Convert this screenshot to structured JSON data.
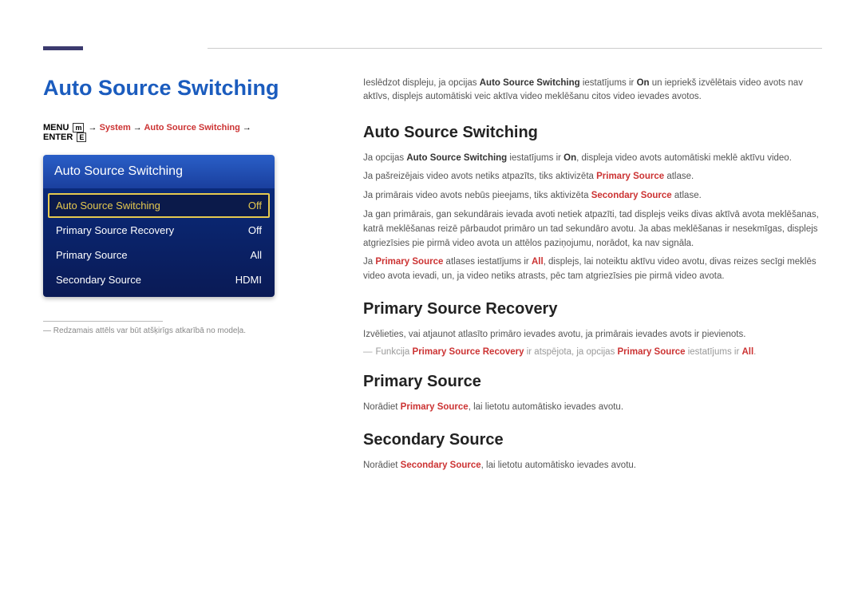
{
  "page_title": "Auto Source Switching",
  "nav": {
    "menu": "MENU",
    "menu_icon": "m",
    "arrow": "→",
    "system": "System",
    "item": "Auto Source Switching",
    "enter": "ENTER",
    "enter_icon": "E"
  },
  "panel": {
    "header": "Auto Source Switching",
    "rows": [
      {
        "label": "Auto Source Switching",
        "value": "Off",
        "selected": true
      },
      {
        "label": "Primary Source Recovery",
        "value": "Off",
        "selected": false
      },
      {
        "label": "Primary Source",
        "value": "All",
        "selected": false
      },
      {
        "label": "Secondary Source",
        "value": "HDMI",
        "selected": false
      }
    ]
  },
  "footnote_marker": "―",
  "footnote": "Redzamais attēls var būt atšķirīgs atkarībā no modeļa.",
  "intro": {
    "t1": "Ieslēdzot displeju, ja opcijas ",
    "b1": "Auto Source Switching",
    "t2": " iestatījums ir ",
    "b2": "On",
    "t3": " un iepriekš izvēlētais video avots nav aktīvs, displejs automātiski veic aktīva video meklēšanu citos video ievades avotos."
  },
  "s1": {
    "h": "Auto Source Switching",
    "p1a": "Ja opcijas ",
    "p1b": "Auto Source Switching",
    "p1c": " iestatījums ir ",
    "p1d": "On",
    "p1e": ", displeja video avots automātiski meklē aktīvu video.",
    "p2a": "Ja pašreizējais video avots netiks atpazīts, tiks aktivizēta ",
    "p2b": "Primary Source",
    "p2c": " atlase.",
    "p3a": "Ja primārais video avots nebūs pieejams, tiks aktivizēta ",
    "p3b": "Secondary Source",
    "p3c": " atlase.",
    "p4": "Ja gan primārais, gan sekundārais ievada avoti netiek atpazīti, tad displejs veiks divas aktīvā avota meklēšanas, katrā meklēšanas reizē pārbaudot primāro un tad sekundāro avotu. Ja abas meklēšanas ir nesekmīgas, displejs atgriezīsies pie pirmā video avota un attēlos paziņojumu, norādot, ka nav signāla.",
    "p5a": "Ja ",
    "p5b": "Primary Source",
    "p5c": " atlases iestatījums ir ",
    "p5d": "All",
    "p5e": ", displejs, lai noteiktu aktīvu video avotu, divas reizes secīgi meklēs video avota ievadi, un, ja video netiks atrasts, pēc tam atgriezīsies pie pirmā video avota."
  },
  "s2": {
    "h": "Primary Source Recovery",
    "p1": "Izvēlieties, vai atjaunot atlasīto primāro ievades avotu, ja primārais ievades avots ir pievienots.",
    "n_a": "Funkcija ",
    "n_b": "Primary Source Recovery",
    "n_c": " ir atspējota, ja opcijas ",
    "n_d": "Primary Source",
    "n_e": " iestatījums ir ",
    "n_f": "All",
    "n_g": "."
  },
  "s3": {
    "h": "Primary Source",
    "p1a": "Norādiet ",
    "p1b": "Primary Source",
    "p1c": ", lai lietotu automātisko ievades avotu."
  },
  "s4": {
    "h": "Secondary Source",
    "p1a": "Norādiet ",
    "p1b": "Secondary Source",
    "p1c": ", lai lietotu automātisko ievades avotu."
  }
}
